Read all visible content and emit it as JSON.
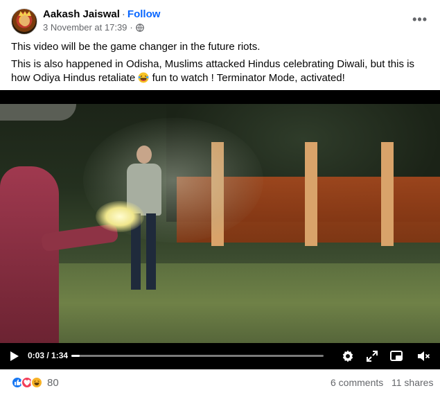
{
  "post": {
    "author": "Aakash Jaiswal",
    "separator": "·",
    "follow_label": "Follow",
    "timestamp": "3 November at 17:39",
    "meta_separator": "·",
    "privacy_icon": "globe-icon",
    "more_label": "•••",
    "text_line1": "This video will be the game changer in the future riots.",
    "text_line2_part1": "This is also happened in Odisha, Muslims attacked Hindus celebrating Diwali, but this is how Odiya Hindus retaliate",
    "text_line2_emoji": "laughing-crying-emoji",
    "text_line2_part2": "fun to watch ! Terminator Mode, activated!"
  },
  "video": {
    "current_time": "0:03",
    "time_separator": " / ",
    "duration": "1:34",
    "progress": 0.032,
    "icons": [
      "play-icon",
      "settings-icon",
      "expand-icon",
      "pip-icon",
      "volume-muted-icon"
    ]
  },
  "footer": {
    "reaction_icons": [
      "like-reaction-icon",
      "love-reaction-icon",
      "haha-reaction-icon"
    ],
    "reaction_count": "80",
    "comments": "6 comments",
    "shares": "11 shares"
  },
  "colors": {
    "accent": "#0866ff",
    "secondary_text": "#65676b",
    "like": "#1877f2",
    "love": "#f33e58",
    "haha": "#f7b125"
  }
}
